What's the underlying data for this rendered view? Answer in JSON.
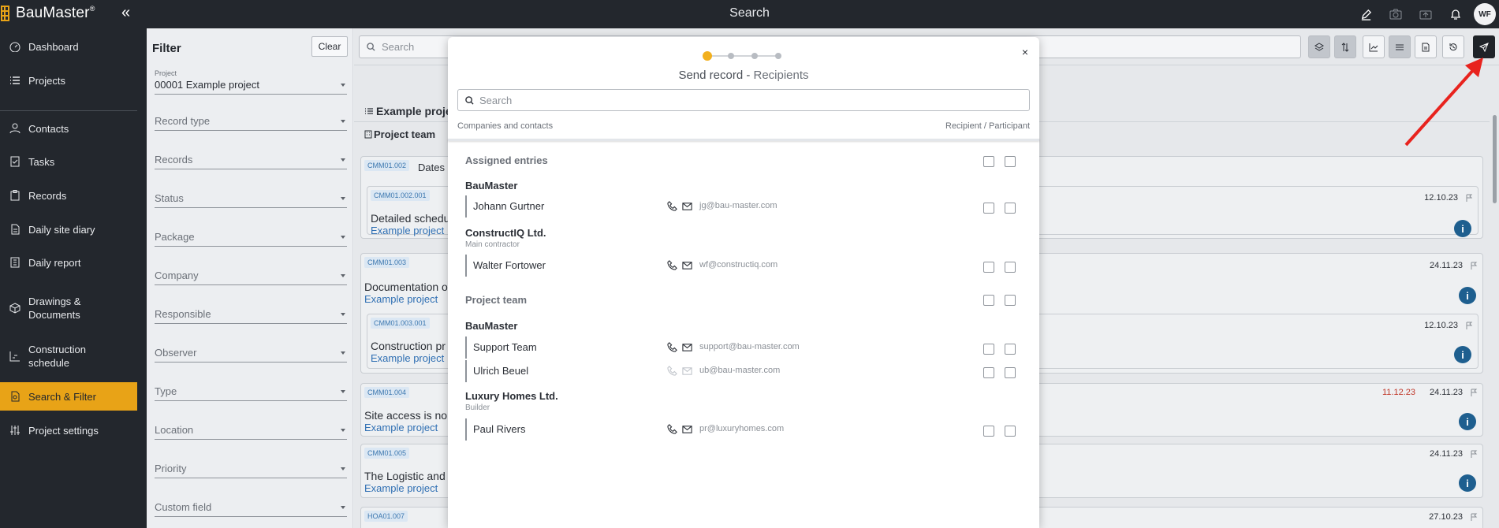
{
  "app": {
    "name": "BauMaster",
    "trademark": "®",
    "page_title": "Search",
    "avatar_initials": "WF",
    "accent_color": "#e8a317",
    "dark_color": "#23272d",
    "link_color": "#2f6fb3"
  },
  "topbar": {
    "icons": [
      "edit-icon",
      "camera-icon",
      "upload-icon",
      "bell-icon"
    ]
  },
  "sidebar": {
    "items": [
      {
        "label": "Dashboard",
        "icon": "dashboard-icon"
      },
      {
        "label": "Projects",
        "icon": "list-icon"
      },
      {
        "label": "Contacts",
        "icon": "person-icon"
      },
      {
        "label": "Tasks",
        "icon": "checklist-icon"
      },
      {
        "label": "Records",
        "icon": "clipboard-icon"
      },
      {
        "label": "Daily site diary",
        "icon": "document-icon"
      },
      {
        "label": "Daily report",
        "icon": "report-icon"
      },
      {
        "label": "Drawings & Documents",
        "icon": "cube-icon"
      },
      {
        "label": "Construction schedule",
        "icon": "chart-icon"
      },
      {
        "label": "Search & Filter",
        "icon": "search-filter-icon",
        "active": true
      },
      {
        "label": "Project settings",
        "icon": "sliders-icon"
      }
    ]
  },
  "filter": {
    "title": "Filter",
    "clear_label": "Clear",
    "project": {
      "caption": "Project",
      "value": "00001 Example project"
    },
    "fields": [
      "Record type",
      "Records",
      "Status",
      "Package",
      "Company",
      "Responsible",
      "Observer",
      "Type",
      "Location",
      "Priority",
      "Custom field"
    ]
  },
  "main": {
    "search_placeholder": "Search",
    "list_title": "Example proje",
    "team_title": "Project team",
    "records": [
      {
        "code": "CMM01.002",
        "title": "Dates a"
      },
      {
        "code": "CMM01.002.001",
        "title": "Detailed schedu",
        "project": "Example project",
        "date": "12.10.23"
      },
      {
        "code": "CMM01.003",
        "title": "Documentation o",
        "project": "Example project",
        "date": "24.11.23"
      },
      {
        "code": "CMM01.003.001",
        "title": "Construction pr",
        "project": "Example project",
        "date": "12.10.23"
      },
      {
        "code": "CMM01.004",
        "title": "Site access is no",
        "project": "Example project",
        "date": "24.11.23",
        "overdue_date": "11.12.23"
      },
      {
        "code": "CMM01.005",
        "title": "The Logistic and",
        "project": "Example project",
        "date": "24.11.23"
      },
      {
        "code": "HOA01.007",
        "date": "27.10.23"
      }
    ]
  },
  "modal": {
    "title": "Send record - ",
    "subtitle": "Recipients",
    "close": "×",
    "search_placeholder": "Search",
    "col_left": "Companies and contacts",
    "col_right": "Recipient / Participant",
    "steps_total": 4,
    "step_current": 1,
    "sections": [
      {
        "title": "Assigned entries",
        "companies": [
          {
            "name": "BauMaster",
            "role": "",
            "people": [
              {
                "name": "Johann Gurtner",
                "email": "jg@bau-master.com"
              }
            ]
          },
          {
            "name": "ConstructIQ Ltd.",
            "role": "Main contractor",
            "people": [
              {
                "name": "Walter Fortower",
                "email": "wf@constructiq.com"
              }
            ]
          }
        ]
      },
      {
        "title": "Project team",
        "companies": [
          {
            "name": "BauMaster",
            "role": "",
            "people": [
              {
                "name": "Support Team",
                "email": "support@bau-master.com"
              },
              {
                "name": "Ulrich Beuel",
                "email": "ub@bau-master.com",
                "contact_disabled": true
              }
            ]
          },
          {
            "name": "Luxury Homes Ltd.",
            "role": "Builder",
            "people": [
              {
                "name": "Paul Rivers",
                "email": "pr@luxuryhomes.com"
              }
            ]
          }
        ]
      }
    ]
  }
}
